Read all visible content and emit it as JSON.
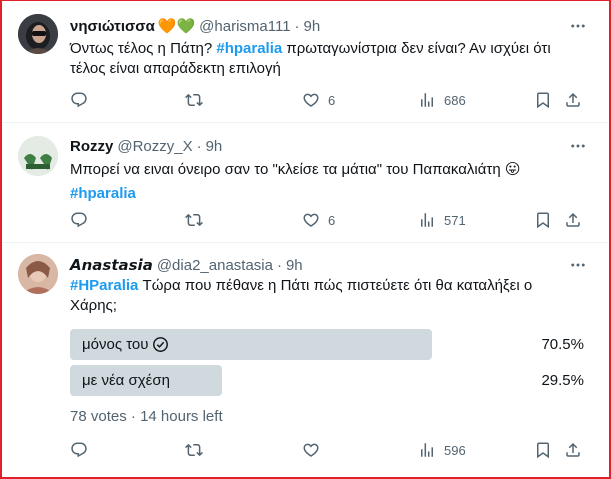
{
  "tweets": [
    {
      "name": "νησιώτισσα",
      "name_emoji": "🧡💚",
      "handle": "@harisma111",
      "dot": "·",
      "time": "9h",
      "text_parts": [
        "Όντως τέλος η Πάτη? ",
        "#hparalia",
        " πρωταγωνίστρια δεν είναι? Αν ισχύει ότι τέλος είναι απαράδεκτη επιλογή"
      ],
      "likes": "6",
      "views": "686"
    },
    {
      "name": "Rozzy",
      "handle": "@Rozzy_X",
      "dot": "·",
      "time": "9h",
      "text_line1": "Μπορεί να ειναι όνειρο σαν το \"κλείσε τα μάτια\" του Παπακαλιάτη 😛",
      "hashtag": "#hparalia",
      "likes": "6",
      "views": "571"
    },
    {
      "name": "𝘼𝙣𝙖𝙨𝙩𝙖𝙨𝙞𝙖",
      "handle": "@dia2_anastasia",
      "dot": "·",
      "time": "9h",
      "hashtag": "#HParalia",
      "text": " Τώρα που πέθανε η Πάτι πώς πιστεύετε ότι θα καταλήξει ο Χάρης;",
      "poll": {
        "options": [
          {
            "label": "μόνος του",
            "percent": "70.5%",
            "fraction": 0.705,
            "winner": true
          },
          {
            "label": "με νέα σχέση",
            "percent": "29.5%",
            "fraction": 0.295,
            "winner": false
          }
        ],
        "votes": "78 votes",
        "dot": "·",
        "time_left": "14 hours left"
      },
      "views": "596"
    }
  ],
  "icons": {
    "more": "more-dots-icon",
    "reply": "reply-icon",
    "retweet": "retweet-icon",
    "like": "heart-icon",
    "views": "views-chart-icon",
    "bookmark": "bookmark-icon",
    "share": "share-icon",
    "checkmark": "checkmark-circle-icon"
  },
  "colors": {
    "hashtag": "#1d9bf0",
    "secondary_text": "#536471",
    "poll_bar": "#cfd9de",
    "border": "#e0202a"
  }
}
